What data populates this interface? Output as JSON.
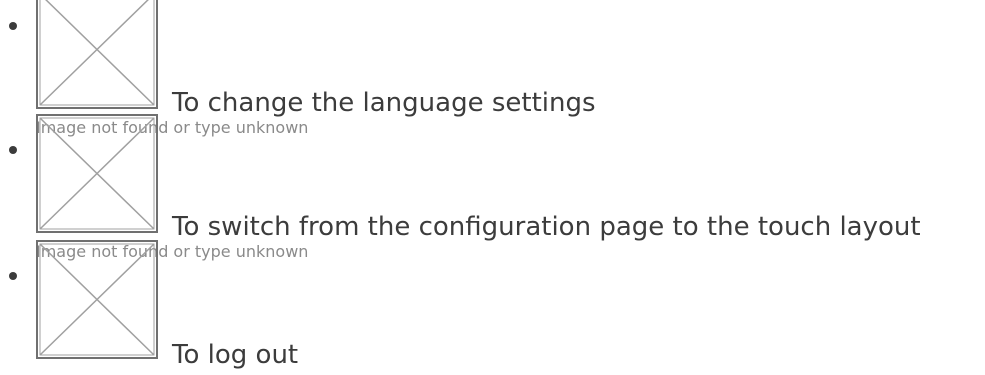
{
  "image_placeholder": {
    "alt_text": "Image not found or type unknown",
    "icon": "broken-image-icon",
    "stroke_color": "#707070",
    "alt_color": "#8a8a8a"
  },
  "list": {
    "items": [
      {
        "label": "To change the language settings"
      },
      {
        "label": "To switch from the configuration page to the touch layout"
      },
      {
        "label": "To log out"
      }
    ]
  },
  "colors": {
    "text": "#3c3c3c",
    "background": "#ffffff"
  }
}
